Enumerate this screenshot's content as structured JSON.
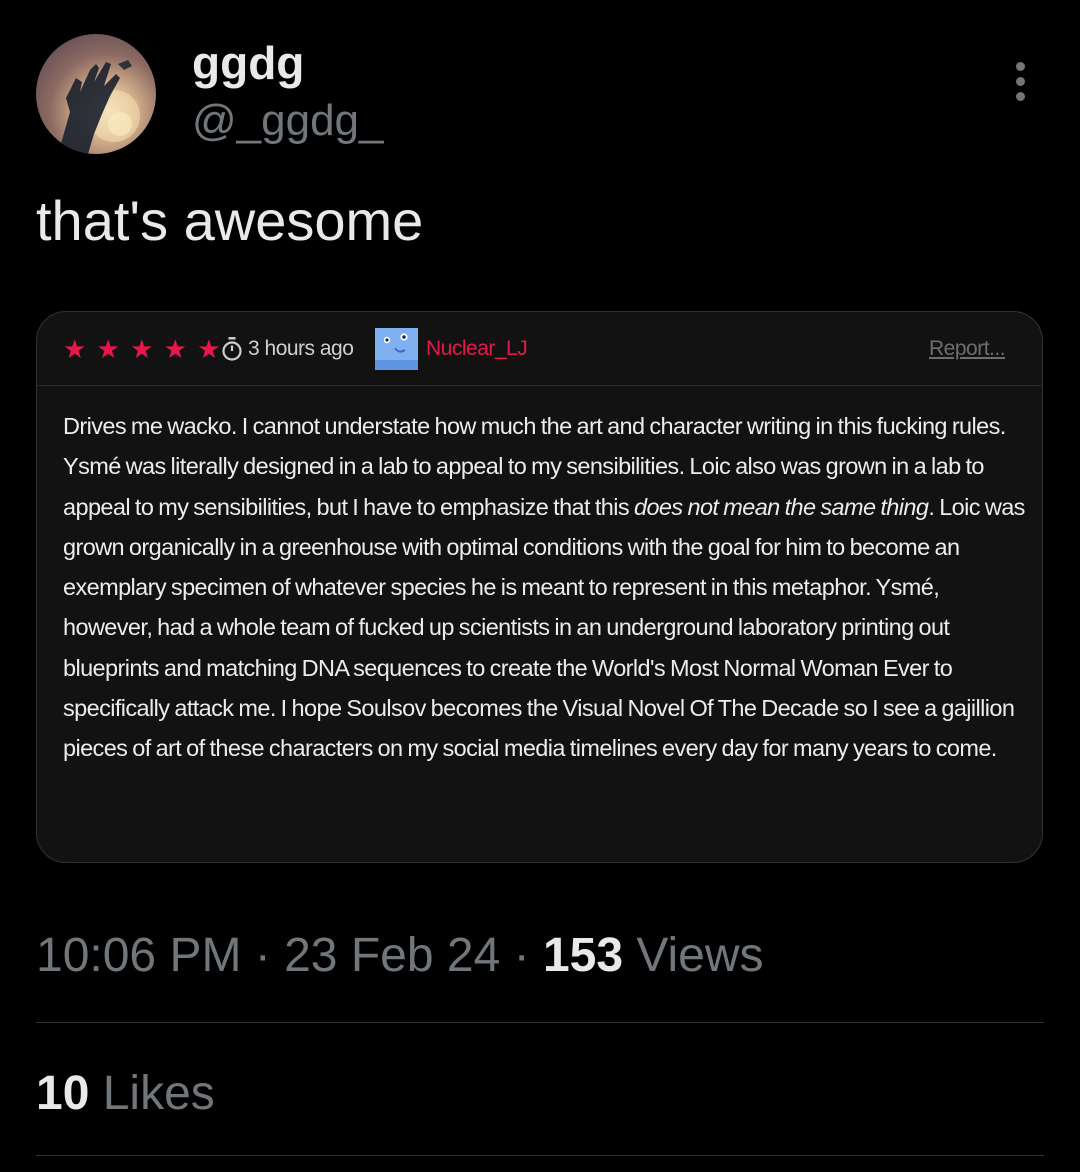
{
  "author": {
    "display_name": "ggdg",
    "handle": "@_ggdg_",
    "avatar_icon": "hand-silhouette-avatar"
  },
  "tweet": {
    "text": "that's awesome",
    "more_icon": "more-vertical-icon"
  },
  "review": {
    "rating_stars": 5,
    "stars": [
      "★",
      "★",
      "★",
      "★",
      "★"
    ],
    "star_color": "#e8174b",
    "time_ago": "3 hours ago",
    "reviewer_name": "Nuclear_LJ",
    "reviewer_name_color": "#e8174b",
    "report_label": "Report...",
    "body_part1": "Drives me wacko. I cannot understate how much the art and character writing in this fucking rules. Ysmé was literally designed in a lab to appeal to my sensibilities. Loic also was grown in a lab to appeal to my sensibilities, but I have to emphasize that this ",
    "body_emphasis": "does not mean the same thing",
    "body_part2": ". Loic was grown organically in a greenhouse with optimal conditions with the goal for him to become an exemplary specimen of whatever species he is meant to represent in this metaphor. Ysmé, however, had a whole team of fucked up scientists in an underground laboratory printing out blueprints and matching DNA sequences to create the World's Most Normal Woman Ever to specifically attack me. I hope Soulsov becomes the Visual Novel Of The Decade so I see a gajillion pieces of art of these characters on my social media timelines every day for many years to come."
  },
  "meta": {
    "time": "10:06 PM",
    "separator": " · ",
    "date": "23 Feb 24",
    "views_count": "153",
    "views_label": " Views"
  },
  "engagement": {
    "likes_count": "10",
    "likes_label": " Likes"
  },
  "colors": {
    "background": "#000000",
    "primary_text": "#e7e9ea",
    "secondary_text": "#71767b",
    "accent_red": "#e8174b"
  }
}
